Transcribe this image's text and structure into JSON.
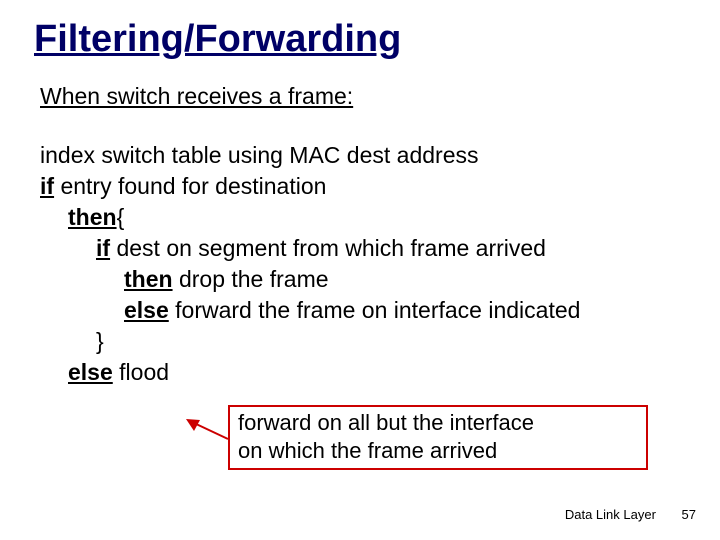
{
  "title": "Filtering/Forwarding",
  "subhead": "When switch receives a frame:",
  "algo": {
    "l1_pre": "index switch table using MAC dest address",
    "l2_kw": "if",
    "l2_txt": " entry found for destination",
    "l3_kw": "then",
    "l3_txt": "{",
    "l4_kw": "if",
    "l4_txt": " dest on segment from which frame arrived",
    "l5_kw": "then",
    "l5_txt": " drop the frame",
    "l6_kw": "else",
    "l6_txt": " forward the frame on interface indicated",
    "l7_txt": "}",
    "l8_kw": "else",
    "l8_txt": " flood"
  },
  "callout": {
    "line1": "forward on all but the interface",
    "line2": "on which the frame arrived"
  },
  "footer": {
    "section": "Data Link Layer",
    "page": "57"
  },
  "colors": {
    "title": "#000066",
    "callout_border": "#cc0000",
    "arrow": "#cc0000"
  }
}
